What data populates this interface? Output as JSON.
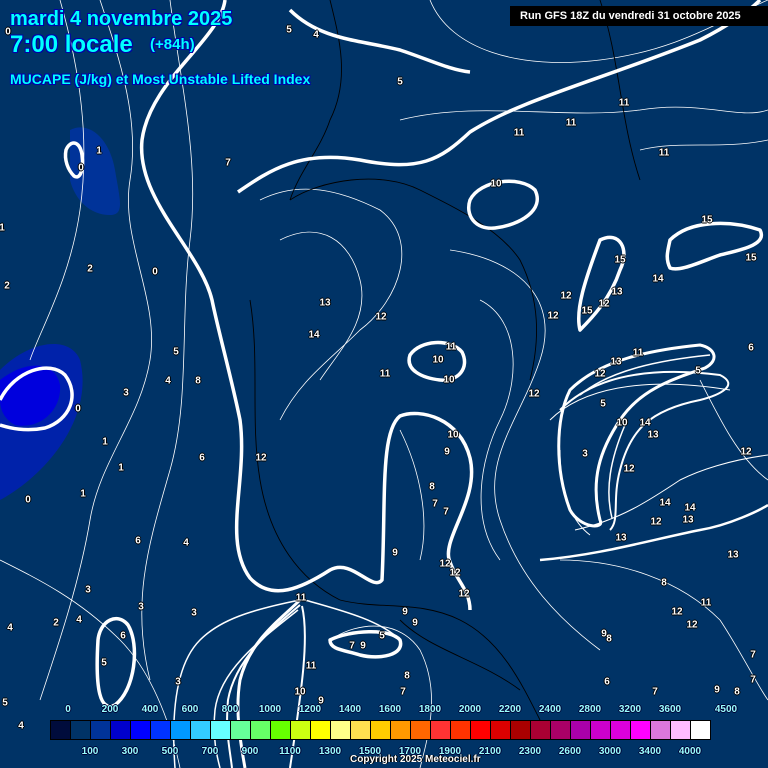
{
  "header": {
    "date": "mardi 4 novembre 2025",
    "time": "7:00 locale",
    "lead": "(+84h)",
    "parameter": "MUCAPE (J/kg) et Most Unstable Lifted Index",
    "run": "Run GFS 18Z du vendredi 31 octobre 2025"
  },
  "legend": {
    "top_labels": [
      "0",
      "200",
      "400",
      "600",
      "800",
      "1000",
      "1200",
      "1400",
      "1600",
      "1800",
      "2000",
      "2200",
      "2400",
      "2800",
      "3200",
      "3600",
      "4500"
    ],
    "bottom_labels": [
      "100",
      "300",
      "500",
      "700",
      "900",
      "1100",
      "1300",
      "1500",
      "1700",
      "1900",
      "2100",
      "2300",
      "2600",
      "3000",
      "3400",
      "4000"
    ],
    "colors": [
      "#000c3c",
      "#003366",
      "#003399",
      "#0000cc",
      "#0000ff",
      "#0033ff",
      "#0099ff",
      "#33ccff",
      "#66ffff",
      "#66ff99",
      "#66ff66",
      "#66ff00",
      "#ccff11",
      "#ffff00",
      "#ffff88",
      "#ffe050",
      "#ffcc00",
      "#ff9900",
      "#ff6600",
      "#ff3333",
      "#ff3300",
      "#ff0000",
      "#dd0000",
      "#aa0000",
      "#aa0033",
      "#aa0066",
      "#aa00aa",
      "#cc00cc",
      "#dd00dd",
      "#ff00ff",
      "#dd77dd",
      "#ffbbff",
      "#ffffff"
    ]
  },
  "contour_labels": [
    "5",
    "4",
    "5",
    "0",
    "0",
    "1",
    "7",
    "11",
    "11",
    "11",
    "11",
    "10",
    "15",
    "15",
    "15",
    "14",
    "13",
    "12",
    "12",
    "15",
    "12",
    "0",
    "2",
    "2",
    "13",
    "12",
    "14",
    "1",
    "11",
    "10",
    "10",
    "11",
    "6",
    "5",
    "13",
    "11",
    "12",
    "12",
    "5",
    "4",
    "8",
    "3",
    "0",
    "1",
    "1",
    "6",
    "12",
    "10",
    "9",
    "13",
    "14",
    "10",
    "5",
    "3",
    "12",
    "12",
    "8",
    "7",
    "7",
    "0",
    "1",
    "14",
    "14",
    "12",
    "13",
    "13",
    "13",
    "6",
    "4",
    "9",
    "12",
    "12",
    "12",
    "3",
    "3",
    "3",
    "8",
    "11",
    "9",
    "9",
    "12",
    "11",
    "12",
    "4",
    "2",
    "4",
    "6",
    "5",
    "9",
    "8",
    "7",
    "9",
    "5",
    "11",
    "7",
    "7",
    "3",
    "8",
    "6",
    "10",
    "9",
    "7",
    "7",
    "9",
    "8",
    "5",
    "4"
  ],
  "copyright": "Copyright 2025 Meteociel.fr",
  "colors": {
    "background": "#003366",
    "title": "#00ffff"
  }
}
